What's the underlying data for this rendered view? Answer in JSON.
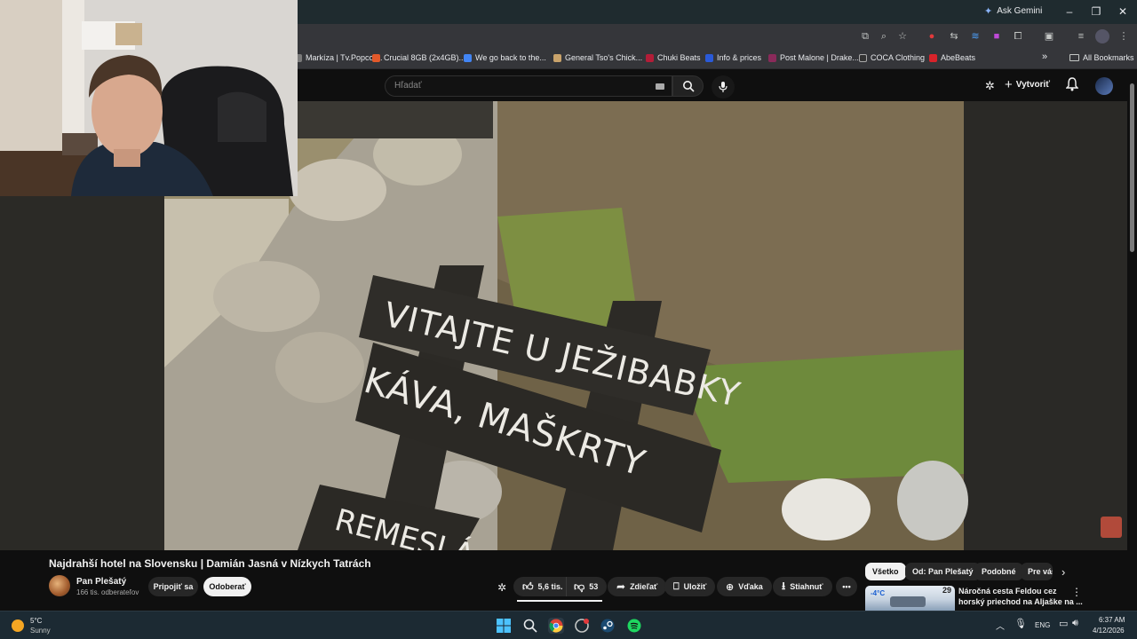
{
  "browser": {
    "ask_gemini": "Ask Gemini",
    "bookmarks": [
      {
        "label": "Markíza | Tv.Popcor...",
        "color": "#7a7a7a"
      },
      {
        "label": "Crucial 8GB (2x4GB)...",
        "color": "#e2592a"
      },
      {
        "label": "We go back to the...",
        "color": "#4285f4"
      },
      {
        "label": "General Tso's Chick...",
        "color": "#c9a36b"
      },
      {
        "label": "Chuki Beats",
        "color": "#b31d38"
      },
      {
        "label": "Info & prices",
        "color": "#2a5ad8"
      },
      {
        "label": "Post Malone | Drake...",
        "color": "#8a2a5a"
      },
      {
        "label": "COCA Clothing",
        "color": "#333333"
      },
      {
        "label": "AbeBeats",
        "color": "#d8232a"
      }
    ],
    "more_bookmarks": "»",
    "all_bookmarks": "All Bookmarks"
  },
  "masthead": {
    "search_placeholder": "Hľadať",
    "create_label": "Vytvoriť"
  },
  "video": {
    "sign_line1": "VITAJTE U JEŽIBABKY",
    "sign_line2": "KÁVA, MAŠKRTY",
    "sign_line3": "REMESLÁ"
  },
  "info": {
    "title": "Najdrahší hotel na Slovensku | Damián Jasná v Nízkych Tatrách",
    "channel": "Pan Plešatý",
    "subscribers": "166 tis. odberateľov",
    "join_label": "Pripojiť sa",
    "subscribed_label": "Odoberať",
    "likes": "5,6 tis.",
    "dislikes": "53",
    "share_label": "Zdieľať",
    "save_label": "Uložiť",
    "thanks_label": "Vďaka",
    "download_label": "Stiahnuť",
    "chips": [
      "Všetko",
      "Od: Pan Plešatý",
      "Podobné",
      "Pre vás"
    ],
    "rec_title_line1": "Náročná cesta Feldou cez",
    "rec_title_line2": "horský priechod na Aljaške na ...",
    "rec_badge": "29"
  },
  "taskbar": {
    "weather_temp": "5°C",
    "weather_desc": "Sunny",
    "lang": "ENG",
    "time": "6:37 AM",
    "date": "4/12/2026"
  }
}
